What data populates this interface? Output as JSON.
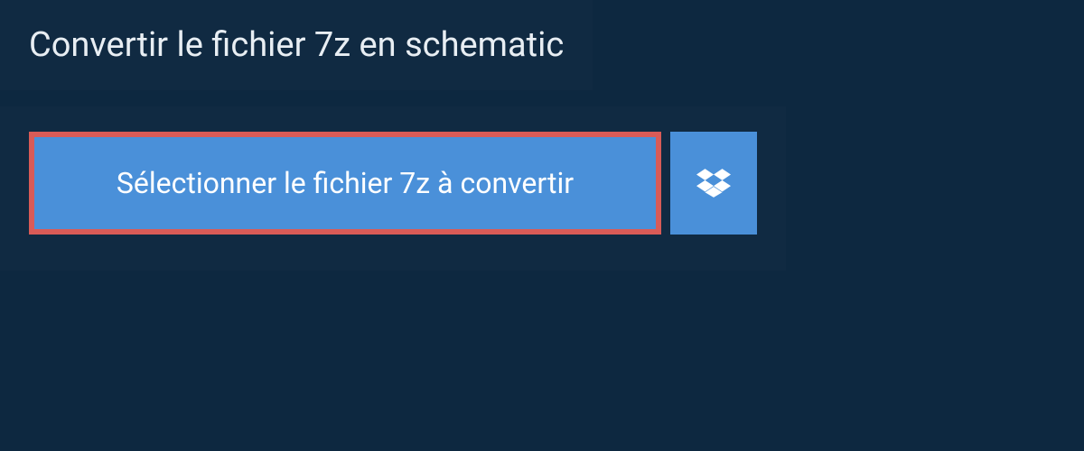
{
  "header": {
    "title": "Convertir le fichier 7z en schematic"
  },
  "main": {
    "select_button_label": "Sélectionner le fichier 7z à convertir"
  },
  "colors": {
    "background": "#0d2840",
    "panel": "#102a42",
    "button": "#4a90d9",
    "highlight_border": "#d95b57",
    "text_light": "#e8eef3",
    "text_white": "#ffffff"
  }
}
